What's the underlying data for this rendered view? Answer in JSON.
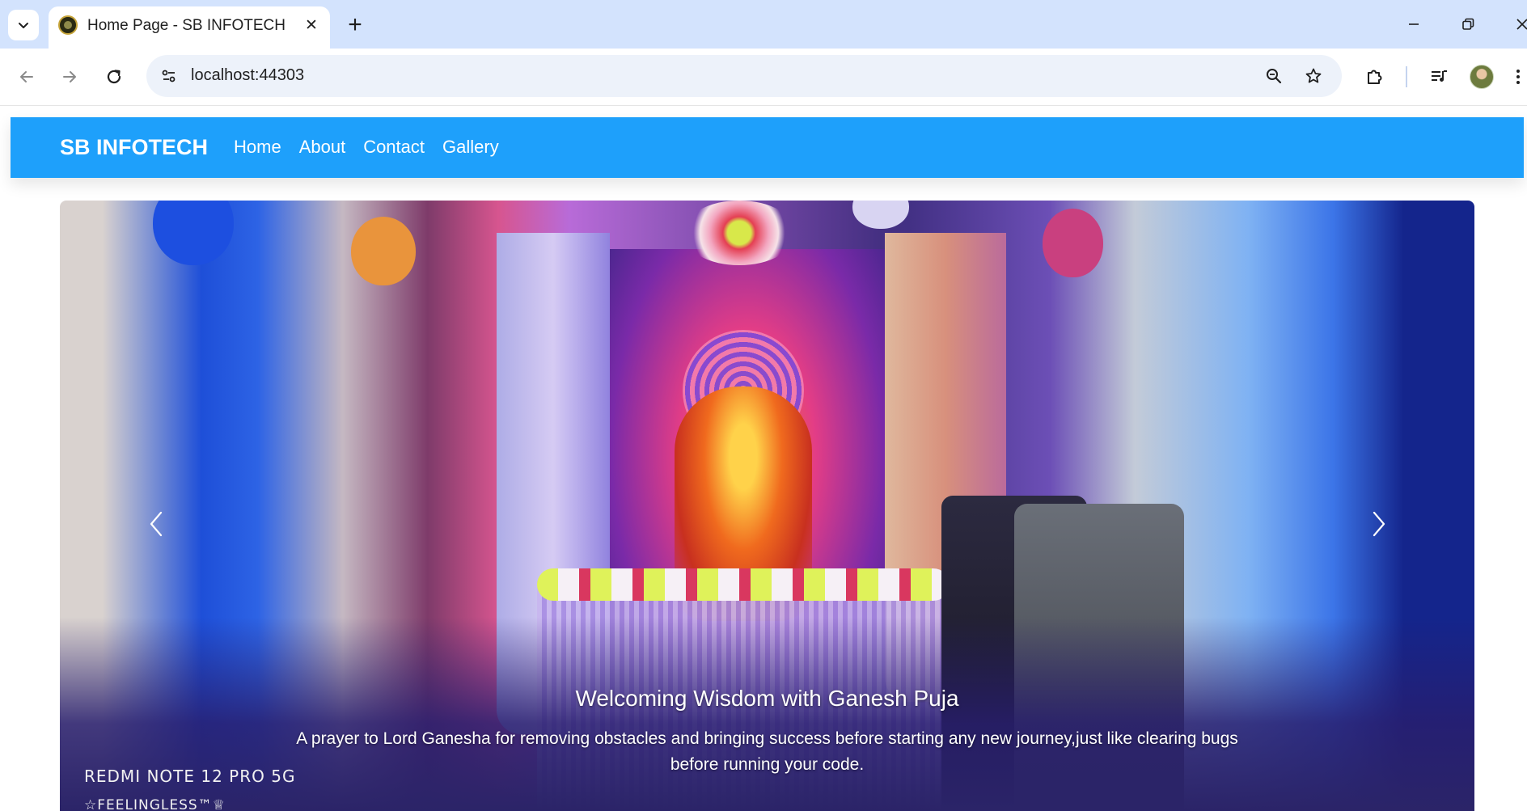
{
  "browser": {
    "tab_title": "Home Page - SB INFOTECH",
    "tab_close": "✕",
    "new_tab": "+",
    "url": "localhost:44303",
    "window_controls": [
      "minimize-icon",
      "restore-icon",
      "close-icon"
    ]
  },
  "navbar": {
    "brand": "SB INFOTECH",
    "links": [
      "Home",
      "About",
      "Contact",
      "Gallery"
    ],
    "background": "#1ea0fb"
  },
  "carousel": {
    "title": "Welcoming Wisdom with Ganesh Puja",
    "text": "A prayer to Lord Ganesha for removing obstacles and bringing success before starting any new journey,just like clearing bugs before running your code.",
    "watermark_line1": "REDMI NOTE 12 PRO 5G",
    "watermark_line2": "☆FEELINGLESS™♕"
  }
}
